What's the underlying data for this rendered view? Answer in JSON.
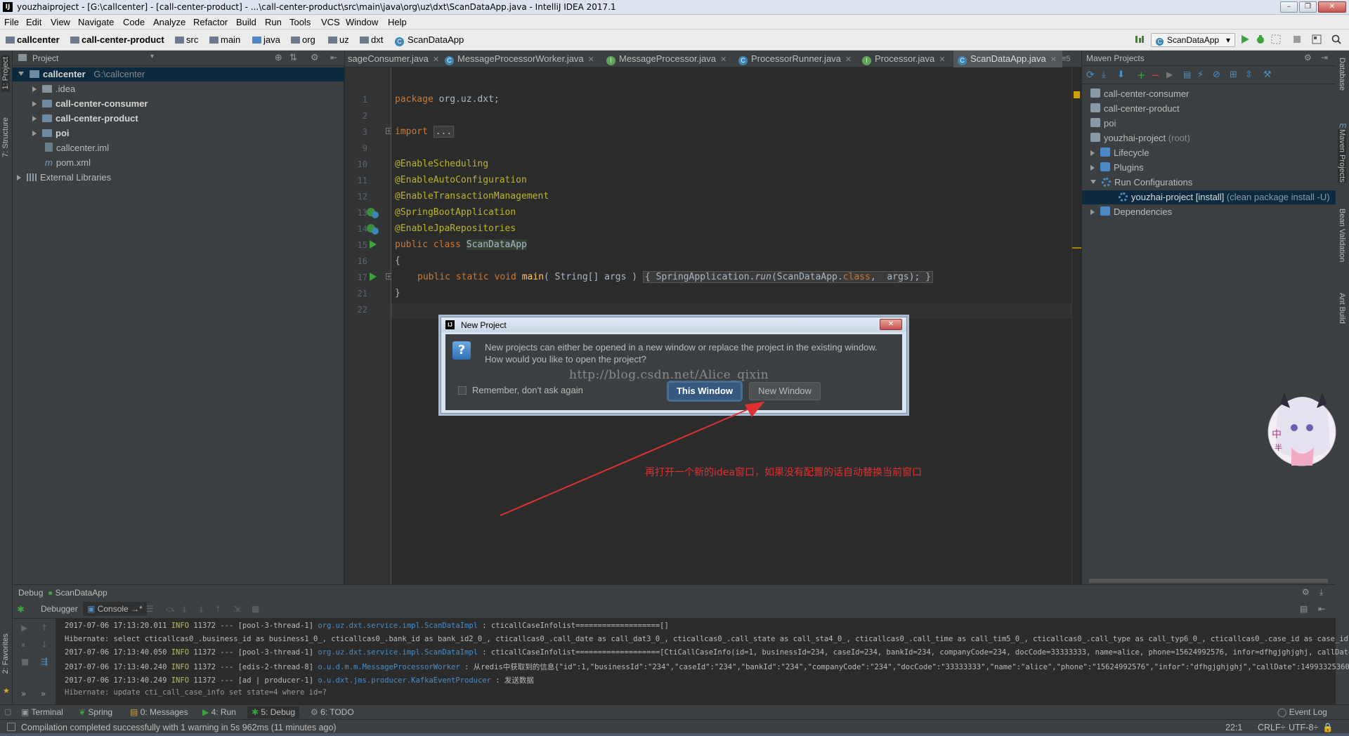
{
  "window": {
    "title": "youzhaiproject - [G:\\callcenter] - [call-center-product] - ...\\call-center-product\\src\\main\\java\\org\\uz\\dxt\\ScanDataApp.java - IntelliJ IDEA 2017.1",
    "app_icon": "IJ",
    "minimize": "–",
    "maximize": "❐",
    "close": "✕"
  },
  "menu": [
    "File",
    "Edit",
    "View",
    "Navigate",
    "Code",
    "Analyze",
    "Refactor",
    "Build",
    "Run",
    "Tools",
    "VCS",
    "Window",
    "Help"
  ],
  "breadcrumbs": [
    "callcenter",
    "call-center-product",
    "src",
    "main",
    "java",
    "org",
    "uz",
    "dxt",
    "ScanDataApp"
  ],
  "run_config": "ScanDataApp",
  "left_strip": {
    "project": "1: Project",
    "structure": "7: Structure",
    "favorites": "2: Favorites"
  },
  "right_strip": {
    "database": "Database",
    "maven": "Maven Projects",
    "bean": "Bean Validation",
    "ant": "Ant Build",
    "maven_short": "m"
  },
  "project_panel": {
    "title": "Project",
    "root": {
      "name": "callcenter",
      "path": "G:\\callcenter"
    },
    "items": [
      {
        "label": ".idea",
        "bold": false
      },
      {
        "label": "call-center-consumer",
        "bold": true
      },
      {
        "label": "call-center-product",
        "bold": true
      },
      {
        "label": "poi",
        "bold": true
      },
      {
        "label": "callcenter.iml",
        "bold": false
      },
      {
        "label": "pom.xml",
        "bold": false
      }
    ],
    "external": "External Libraries"
  },
  "editor_tabs": [
    {
      "label": "sageConsumer.java",
      "icon": "C"
    },
    {
      "label": "MessageProcessorWorker.java",
      "icon": "C"
    },
    {
      "label": "MessageProcessor.java",
      "icon": "I"
    },
    {
      "label": "ProcessorRunner.java",
      "icon": "C"
    },
    {
      "label": "Processor.java",
      "icon": "I"
    },
    {
      "label": "ScanDataApp.java",
      "icon": "C",
      "active": true
    }
  ],
  "tab_overflow": "≡5",
  "gutter_lines": [
    "1",
    "2",
    "3",
    "9",
    "10",
    "11",
    "12",
    "13",
    "14",
    "15",
    "16",
    "17",
    "21",
    "22"
  ],
  "code": {
    "l1_kw": "package",
    "l1_rest": " org.uz.dxt;",
    "l3_kw": "import",
    "l3_fold": "...",
    "l10": "@EnableScheduling",
    "l11": "@EnableAutoConfiguration",
    "l12": "@EnableTransactionManagement",
    "l13": "@SpringBootApplication",
    "l14": "@EnableJpaRepositories",
    "l15_kw": "public class",
    "l15_name": "ScanDataApp",
    "l16": "{",
    "l17_kw": "public static void",
    "l17_fn": "main",
    "l17_a": "( String[] args )",
    "l17_b": " SpringApplication.",
    "l17_run": "run",
    "l17_c": "(ScanDataApp.",
    "l17_class": "class",
    "l17_d": ",  args);",
    "l21": "}"
  },
  "maven": {
    "title": "Maven Projects",
    "items": [
      "call-center-consumer",
      "call-center-product",
      "poi"
    ],
    "root": "youzhai-project",
    "root_suffix": "(root)",
    "lifecycle": "Lifecycle",
    "plugins": "Plugins",
    "runconf": "Run Configurations",
    "selected": "youzhai-project [install]",
    "selected_suffix": "(clean package install -U)",
    "deps": "Dependencies"
  },
  "dialog": {
    "title": "New Project",
    "close": "✕",
    "message_1": "New projects can either be opened in a new window or replace the project in the existing window.",
    "message_2": "How would you like to open the project?",
    "checkbox": "Remember, don't ask again",
    "btn_this": "This Window",
    "btn_new": "New Window"
  },
  "watermark": "http://blog.csdn.net/Alice_qixin",
  "annotation": "再打开一个新的idea窗口，如果没有配置的话自动替换当前窗口",
  "debug": {
    "title": "Debug",
    "config": "ScanDataApp",
    "tab_debugger": "Debugger",
    "tab_console": "Console",
    "console_arrow": "→*",
    "logs": [
      {
        "ts": "2017-07-06 17:13:20.011",
        "lvl": "INFO",
        "pid": "11372",
        "th": "--- [pool-3-thread-1]",
        "cls": "org.uz.dxt.service.impl.ScanDataImpl",
        "msg": "   : cticallCaseInfolist===================[]"
      },
      {
        "ts": "",
        "lvl": "",
        "pid": "",
        "th": "Hibernate: select cticallcas0_.business_id as business1_0_, cticallcas0_.bank_id as bank_id2_0_, cticallcas0_.call_date as call_dat3_0_, cticallcas0_.call_state as call_sta4_0_, cticallcas0_.call_time as call_tim5_0_, cticallcas0_.call_type as call_typ6_0_, cticallcas0_.case_id as case_id7_0_, cticall",
        "cls": "",
        "msg": ""
      },
      {
        "ts": "2017-07-06 17:13:40.050",
        "lvl": "INFO",
        "pid": "11372",
        "th": "--- [pool-3-thread-1]",
        "cls": "org.uz.dxt.service.impl.ScanDataImpl",
        "msg": "   : cticallCaseInfolist===================[CtiCallCaseInfo(id=1, businessId=234, caseId=234, bankId=234, companyCode=234, docCode=33333333, name=alice, phone=15624992576, infor=dfhgjghjghj, callDate=2017-"
      },
      {
        "ts": "2017-07-06 17:13:40.240",
        "lvl": "INFO",
        "pid": "11372",
        "th": "--- [edis-2-thread-8]",
        "cls": "o.u.d.m.m.MessageProcessorWorker",
        "msg": "   : 从redis中获取到的信息{\"id\":1,\"businessId\":\"234\",\"caseId\":\"234\",\"bankId\":\"234\",\"companyCode\":\"234\",\"docCode\":\"33333333\",\"name\":\"alice\",\"phone\":\"15624992576\",\"infor\":\"dfhgjghjghj\",\"callDate\":14993325360"
      },
      {
        "ts": "2017-07-06 17:13:40.249",
        "lvl": "INFO",
        "pid": "11372",
        "th": "--- [ad | producer-1]",
        "cls": "o.u.dxt.jms.producer.KafkaEventProducer",
        "msg": "   : 发送数据"
      },
      {
        "ts": "",
        "lvl": "",
        "pid": "",
        "th": "Hibernate: update cti_call_case_info set state=4 where id=?",
        "cls": "",
        "msg": ""
      }
    ]
  },
  "bottom_tabs": [
    {
      "label": "Terminal"
    },
    {
      "label": "Spring"
    },
    {
      "label": "0: Messages"
    },
    {
      "label": "4: Run"
    },
    {
      "label": "5: Debug",
      "active": true
    },
    {
      "label": "6: TODO"
    }
  ],
  "event_log": "Event Log",
  "status": {
    "message": "Compilation completed successfully with 1 warning in 5s 962ms (11 minutes ago)",
    "position": "22:1",
    "line_sep": "CRLF÷",
    "encoding": "UTF-8÷"
  },
  "colors": {
    "accent": "#4a88c7",
    "annotation": "#e03030",
    "keyword": "#cc7832",
    "annotation_code": "#bbb529"
  }
}
